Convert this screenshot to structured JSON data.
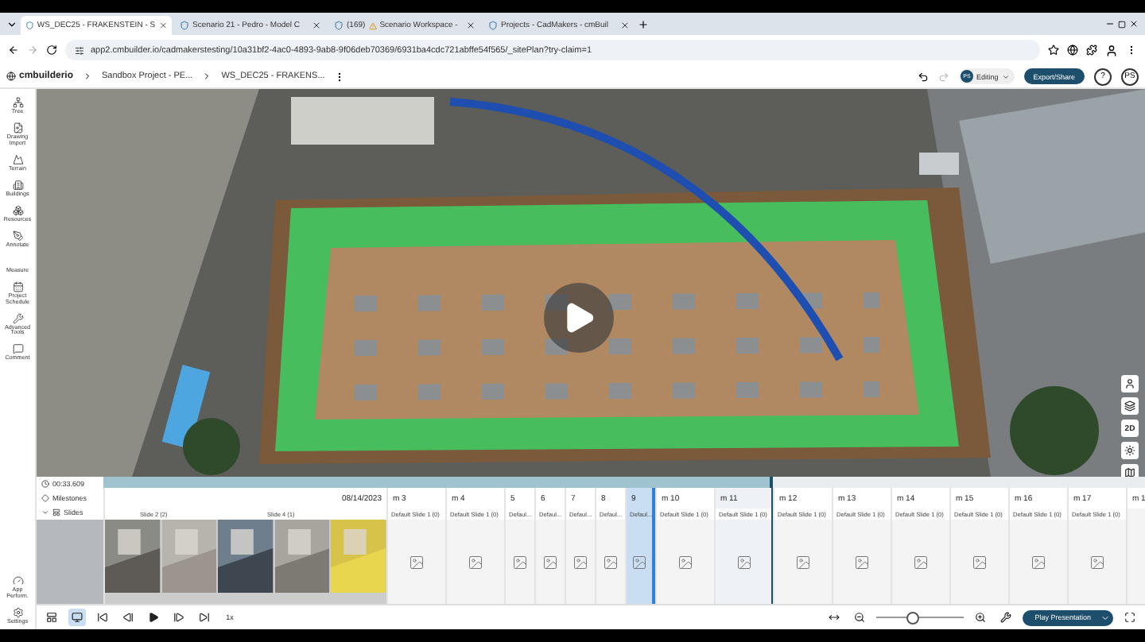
{
  "browser": {
    "tabs": [
      {
        "title": "WS_DEC25 - FRAKENSTEIN - S",
        "selected": true
      },
      {
        "title": "Scenario 21 - Pedro - Model C",
        "selected": false
      },
      {
        "count": "(169)",
        "title": "Scenario Workspace -",
        "selected": false
      },
      {
        "title": "Projects - CadMakers - cmBuil",
        "selected": false
      }
    ],
    "url": "app2.cmbuilder.io/cadmakerstesting/10a31bf2-4ac0-4893-9ab8-9f06deb70369/6931ba4cdc721abffe54f565/_sitePlan?try-claim=1"
  },
  "header": {
    "logo": "cmbuilderio",
    "breadcrumb": [
      "Sandbox Project - PE...",
      "WS_DEC25 - FRAKENS..."
    ],
    "avatar": "PS",
    "mode": "Editing",
    "export": "Export/Share",
    "help": "?",
    "user": "PS"
  },
  "sidebar": {
    "items": [
      {
        "kind": "tree",
        "label": "Tree"
      },
      {
        "kind": "drawing",
        "label": "Drawing Import"
      },
      {
        "kind": "terrain",
        "label": "Terrain"
      },
      {
        "kind": "buildings",
        "label": "Buildings"
      },
      {
        "kind": "resources",
        "label": "Resources"
      },
      {
        "kind": "annotate",
        "label": "Annotate"
      },
      {
        "kind": "measure",
        "label": "Measure"
      },
      {
        "kind": "schedule",
        "label": "Project Schedule"
      },
      {
        "kind": "tools",
        "label": "Advanced Tools"
      },
      {
        "kind": "comment",
        "label": "Comment"
      }
    ],
    "bottom": [
      {
        "kind": "perform",
        "label": "App Perform."
      },
      {
        "kind": "settings",
        "label": "Settings"
      }
    ]
  },
  "viewport": {
    "toolbar": [
      {
        "kind": "person"
      },
      {
        "kind": "layers"
      },
      {
        "kind": "text",
        "label": "2D"
      },
      {
        "kind": "sun"
      },
      {
        "kind": "map"
      }
    ]
  },
  "timeline": {
    "time": "00:33.609",
    "milestones_label": "Milestones",
    "slides_label": "Slides",
    "playback": {
      "level": 0.64
    },
    "first": {
      "date": "08/14/2023",
      "slides": [
        {
          "label": "Slide 2 (2)"
        },
        {
          "label": "Slide 4 (1)"
        }
      ]
    },
    "columns": [
      {
        "label": "m 3",
        "kind": "wide",
        "slide": "Default Slide 1 (0)",
        "selected": false,
        "current": false
      },
      {
        "label": "m 4",
        "kind": "wide",
        "slide": "Default Slide 1 (0)",
        "selected": false,
        "current": false
      },
      {
        "label": "5",
        "kind": "narrow",
        "slide": "Defaul...",
        "selected": false,
        "current": false
      },
      {
        "label": "6",
        "kind": "narrow",
        "slide": "Defaul...",
        "selected": false,
        "current": false
      },
      {
        "label": "7",
        "kind": "narrow",
        "slide": "Defaul...",
        "selected": false,
        "current": false
      },
      {
        "label": "8",
        "kind": "narrow",
        "slide": "Defaul...",
        "selected": false,
        "current": false
      },
      {
        "label": "9",
        "kind": "narrow",
        "slide": "Defaul...",
        "selected": true,
        "current": false
      },
      {
        "label": "m 10",
        "kind": "wide",
        "slide": "Default Slide 1 (0)",
        "selected": false,
        "current": false
      },
      {
        "label": "m 11",
        "kind": "wide",
        "slide": "Default Slide 1 (0)",
        "selected": false,
        "current": true
      },
      {
        "label": "m 12",
        "kind": "wide",
        "slide": "Default Slide 1 (0)",
        "selected": false,
        "current": false
      },
      {
        "label": "m 13",
        "kind": "wide",
        "slide": "Default Slide 1 (0)",
        "selected": false,
        "current": false
      },
      {
        "label": "m 14",
        "kind": "wide",
        "slide": "Default Slide 1 (0)",
        "selected": false,
        "current": false
      },
      {
        "label": "m 15",
        "kind": "wide",
        "slide": "Default Slide 1 (0)",
        "selected": false,
        "current": false
      },
      {
        "label": "m 16",
        "kind": "wide",
        "slide": "Default Slide 1 (0)",
        "selected": false,
        "current": false
      },
      {
        "label": "m 17",
        "kind": "wide",
        "slide": "Default Slide 1 (0)",
        "selected": false,
        "current": false
      },
      {
        "label": "m 1",
        "kind": "edge",
        "selected": false,
        "current": false
      }
    ]
  },
  "controls": {
    "speed": "1x",
    "zoom": {
      "level": 0.4
    },
    "play": "Play Presentation"
  }
}
